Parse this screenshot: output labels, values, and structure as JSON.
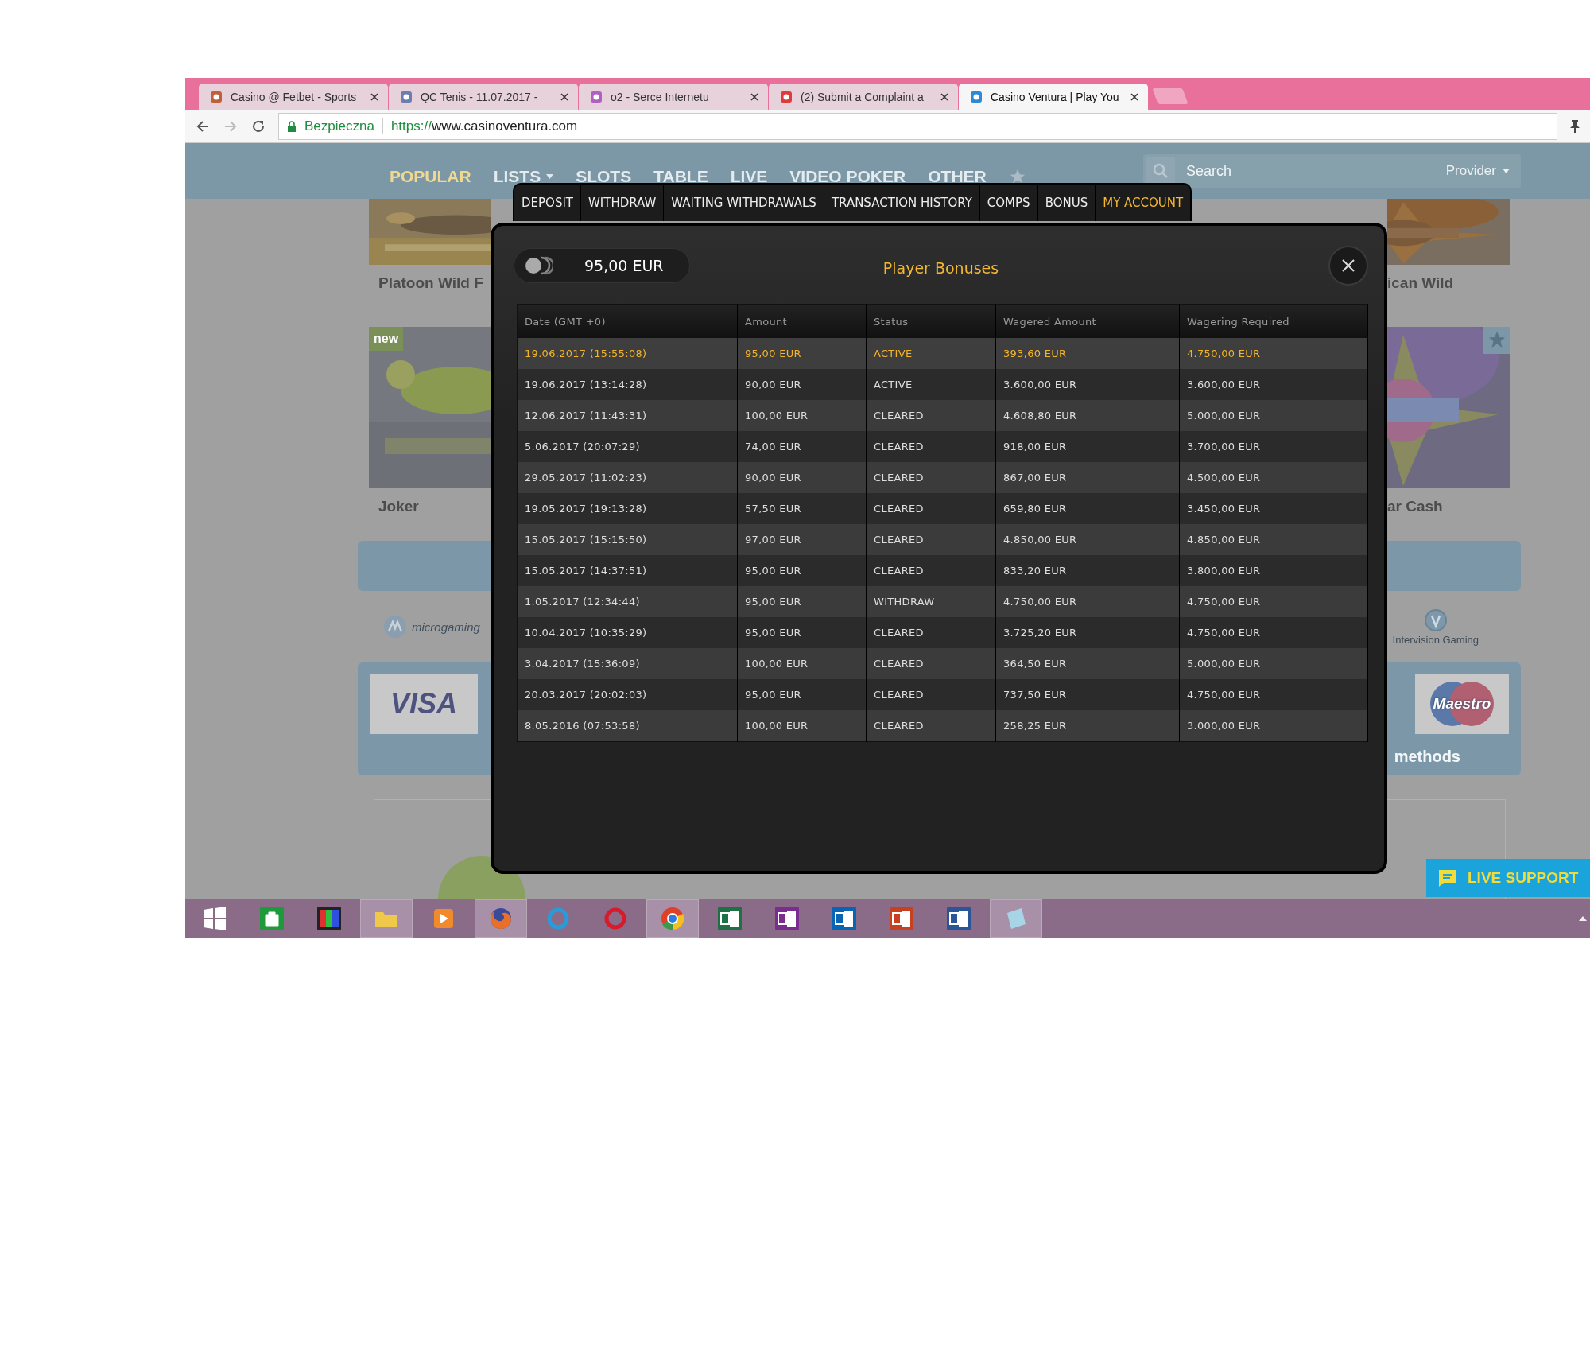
{
  "browser": {
    "tabs": [
      {
        "title": "Casino @ Fetbet - Sports",
        "selected": false
      },
      {
        "title": "QC Tenis - 11.07.2017 -",
        "selected": false
      },
      {
        "title": "o2 - Serce Internetu",
        "selected": false
      },
      {
        "title": "(2) Submit a Complaint a",
        "selected": false
      },
      {
        "title": "Casino Ventura | Play You",
        "selected": true
      }
    ],
    "address": {
      "security": "Bezpieczna",
      "scheme": "https://",
      "host": "www.casinoventura.com"
    }
  },
  "site": {
    "nav": [
      {
        "label": "POPULAR",
        "selected": true,
        "dropdown": false
      },
      {
        "label": "LISTS",
        "selected": false,
        "dropdown": true
      },
      {
        "label": "SLOTS",
        "selected": false,
        "dropdown": false
      },
      {
        "label": "TABLE",
        "selected": false,
        "dropdown": false
      },
      {
        "label": "LIVE",
        "selected": false,
        "dropdown": false
      },
      {
        "label": "VIDEO POKER",
        "selected": false,
        "dropdown": false
      },
      {
        "label": "OTHER",
        "selected": false,
        "dropdown": false
      }
    ],
    "search": {
      "placeholder": "Search",
      "provider": "Provider"
    },
    "game_rows": [
      {
        "left": {
          "title": "Platoon Wild F"
        },
        "right": {
          "title": "ican Wild",
          "favorite": false
        }
      },
      {
        "left": {
          "title": "Joker",
          "badge": "new"
        },
        "right": {
          "title": "ar Cash",
          "favorite": true
        }
      }
    ],
    "providers": [
      "microgaming",
      "Intervision Gaming"
    ],
    "payments": [
      "VISA",
      "Maestro"
    ],
    "payments_caption": "methods",
    "live_support": "LIVE SUPPORT"
  },
  "modal": {
    "tabs": [
      {
        "label": "DEPOSIT",
        "selected": false
      },
      {
        "label": "WITHDRAW",
        "selected": false
      },
      {
        "label": "WAITING WITHDRAWALS",
        "selected": false
      },
      {
        "label": "TRANSACTION HISTORY",
        "selected": false
      },
      {
        "label": "COMPS",
        "selected": false
      },
      {
        "label": "BONUS",
        "selected": false
      },
      {
        "label": "MY ACCOUNT",
        "selected": true
      }
    ],
    "balance": "95,00 EUR",
    "title": "Player Bonuses",
    "table": {
      "columns": [
        "Date (GMT +0)",
        "Amount",
        "Status",
        "Wagered Amount",
        "Wagering Required"
      ],
      "rows": [
        {
          "cells": [
            "19.06.2017 (15:55:08)",
            "95,00 EUR",
            "ACTIVE",
            "393,60 EUR",
            "4.750,00 EUR"
          ],
          "selected": true
        },
        {
          "cells": [
            "19.06.2017 (13:14:28)",
            "90,00 EUR",
            "ACTIVE",
            "3.600,00 EUR",
            "3.600,00 EUR"
          ],
          "selected": false
        },
        {
          "cells": [
            "12.06.2017 (11:43:31)",
            "100,00 EUR",
            "CLEARED",
            "4.608,80 EUR",
            "5.000,00 EUR"
          ],
          "selected": false
        },
        {
          "cells": [
            "5.06.2017 (20:07:29)",
            "74,00 EUR",
            "CLEARED",
            "918,00 EUR",
            "3.700,00 EUR"
          ],
          "selected": false
        },
        {
          "cells": [
            "29.05.2017 (11:02:23)",
            "90,00 EUR",
            "CLEARED",
            "867,00 EUR",
            "4.500,00 EUR"
          ],
          "selected": false
        },
        {
          "cells": [
            "19.05.2017 (19:13:28)",
            "57,50 EUR",
            "CLEARED",
            "659,80 EUR",
            "3.450,00 EUR"
          ],
          "selected": false
        },
        {
          "cells": [
            "15.05.2017 (15:15:50)",
            "97,00 EUR",
            "CLEARED",
            "4.850,00 EUR",
            "4.850,00 EUR"
          ],
          "selected": false
        },
        {
          "cells": [
            "15.05.2017 (14:37:51)",
            "95,00 EUR",
            "CLEARED",
            "833,20 EUR",
            "3.800,00 EUR"
          ],
          "selected": false
        },
        {
          "cells": [
            "1.05.2017 (12:34:44)",
            "95,00 EUR",
            "WITHDRAW",
            "4.750,00 EUR",
            "4.750,00 EUR"
          ],
          "selected": false
        },
        {
          "cells": [
            "10.04.2017 (10:35:29)",
            "95,00 EUR",
            "CLEARED",
            "3.725,20 EUR",
            "4.750,00 EUR"
          ],
          "selected": false
        },
        {
          "cells": [
            "3.04.2017 (15:36:09)",
            "100,00 EUR",
            "CLEARED",
            "364,50 EUR",
            "5.000,00 EUR"
          ],
          "selected": false
        },
        {
          "cells": [
            "20.03.2017 (20:02:03)",
            "95,00 EUR",
            "CLEARED",
            "737,50 EUR",
            "4.750,00 EUR"
          ],
          "selected": false
        },
        {
          "cells": [
            "8.05.2016 (07:53:58)",
            "100,00 EUR",
            "CLEARED",
            "258,25 EUR",
            "3.000,00 EUR"
          ],
          "selected": false
        }
      ]
    }
  },
  "taskbar": {
    "apps": [
      {
        "kind": "windows",
        "selected": false
      },
      {
        "kind": "store",
        "selected": false
      },
      {
        "kind": "photos",
        "selected": false
      },
      {
        "kind": "folder",
        "selected": true
      },
      {
        "kind": "player",
        "selected": false
      },
      {
        "kind": "firefox",
        "selected": true
      },
      {
        "kind": "ie",
        "selected": false
      },
      {
        "kind": "opera",
        "selected": false
      },
      {
        "kind": "chrome",
        "selected": true
      },
      {
        "kind": "excel",
        "selected": false
      },
      {
        "kind": "onenote",
        "selected": false
      },
      {
        "kind": "outlook",
        "selected": false
      },
      {
        "kind": "powerpoint",
        "selected": false
      },
      {
        "kind": "word",
        "selected": false
      },
      {
        "kind": "notes",
        "selected": true
      }
    ]
  }
}
